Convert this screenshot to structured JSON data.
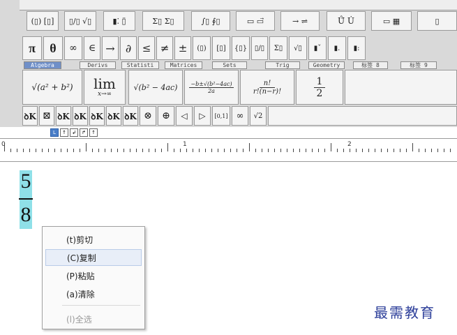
{
  "toolbar_row1": [
    "(▯) [▯]",
    "▯/▯ √▯",
    "▮⁚ ▯̈",
    "Σ▯ Σ▯",
    "∫▯ ∮▯",
    "▭ ▭⃗",
    "→ ⇌",
    "Û̈ U̇",
    "▭ ▦",
    "▯"
  ],
  "toolbar_row2": [
    "π",
    "θ",
    "∞",
    "∈",
    "→",
    "∂",
    "≤",
    "≠",
    "±",
    "(▯)",
    "[▯]",
    "{▯}",
    "▯/▯",
    "Σ▯",
    "√▯",
    "▮ˇ",
    "▮.",
    "▮:"
  ],
  "tabs": [
    "Algebra",
    "Derivs",
    "Statisti",
    "Matrices",
    "Sets",
    "Trig",
    "Geometry",
    "标签 8",
    "标签 9"
  ],
  "templates": {
    "t1": "√(a² + b²)",
    "t2_top": "lim",
    "t2_bottom": "x→∞",
    "t3": "√(b² − 4ac)",
    "t4_num": "−b±√(b²−4ac)",
    "t4_den": "2a",
    "t5_num": "n!",
    "t5_den": "r!(n−r)!",
    "t6_num": "1",
    "t6_den": "2"
  },
  "toolbar_row4": [
    "ꝺK",
    "⊠",
    "ꝺK",
    "ꝺK",
    "ꝺK",
    "ꝺK",
    "ꝺK",
    "⊗",
    "⊕",
    "◁",
    "▷",
    "[0,1]",
    "∞",
    "√2"
  ],
  "tab_stop_icons": [
    "L",
    "↑",
    "↲",
    "↱",
    "↑"
  ],
  "ruler": {
    "label0": "0",
    "label1": "1",
    "label2": "2"
  },
  "fraction": {
    "numerator": "5",
    "denominator": "8"
  },
  "context_menu": {
    "cut": "(t)剪切",
    "copy": "(C)复制",
    "paste": "(P)粘贴",
    "clear": "(a)清除",
    "select_all": "(l)全选"
  },
  "watermark": "最需教育",
  "colors": {
    "tab_active": "#6f8fc8",
    "fraction_highlight": "#8fe0e8",
    "menu_highlight": "#e8eef8"
  }
}
